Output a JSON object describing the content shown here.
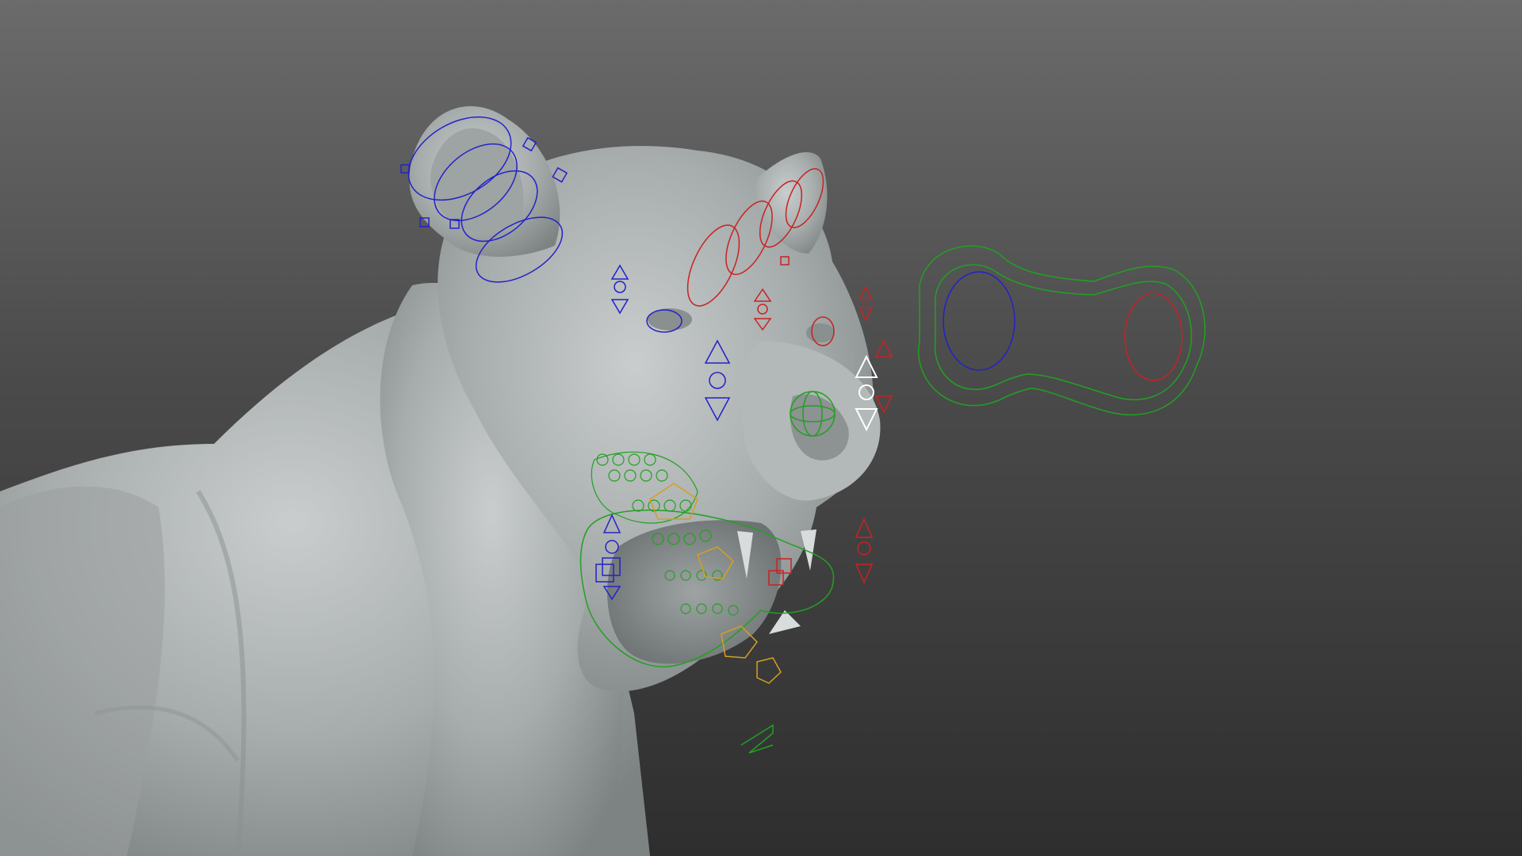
{
  "viewport": {
    "background_top": "#6b6b6b",
    "background_bottom": "#2e2e2e"
  },
  "model": {
    "subject": "lioness sculpt",
    "surface_color": "#b9bdbd"
  },
  "control_colors": {
    "left_side": "#2222c8",
    "right_side": "#c82222",
    "center": "#22a022",
    "secondary": "#d4a020",
    "neutral": "#ffffff"
  },
  "icons": [
    "ear-control-icon",
    "eye-control-icon",
    "nose-control-icon",
    "mouth-control-icon",
    "jaw-control-icon",
    "gaze-control-icon"
  ]
}
